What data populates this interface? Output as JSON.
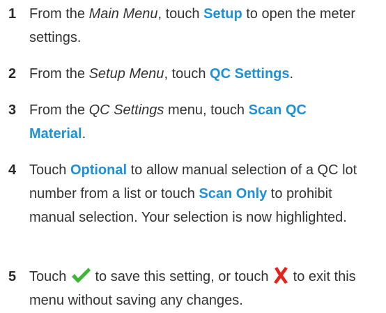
{
  "steps": [
    {
      "number": "1",
      "t1": "From the ",
      "t2": "Main Menu",
      "t3": ", touch ",
      "t4": "Setup",
      "t5": " to open the meter settings."
    },
    {
      "number": "2",
      "t1": "From the ",
      "t2": "Setup Menu",
      "t3": ", touch ",
      "t4": "QC Settings",
      "t5": "."
    },
    {
      "number": "3",
      "t1": "From the ",
      "t2": "QC Settings",
      "t3": " menu, touch ",
      "t4": "Scan QC Material",
      "t5": "."
    },
    {
      "number": "4",
      "t1": "Touch ",
      "t2": "Optional",
      "t3": " to allow manual selection of a QC lot number from a list or touch ",
      "t4": "Scan Only",
      "t5": " to prohibit manual selection. Your selection is now highlighted."
    },
    {
      "number": "5",
      "t1": "Touch ",
      "t2": " to save this setting, or touch ",
      "t3": " to exit this menu without saving any changes.",
      "icon_save": "check-icon",
      "icon_exit": "x-icon"
    }
  ],
  "colors": {
    "keyword": "#1e90d6",
    "check": "#3db535",
    "x": "#e3231b"
  }
}
